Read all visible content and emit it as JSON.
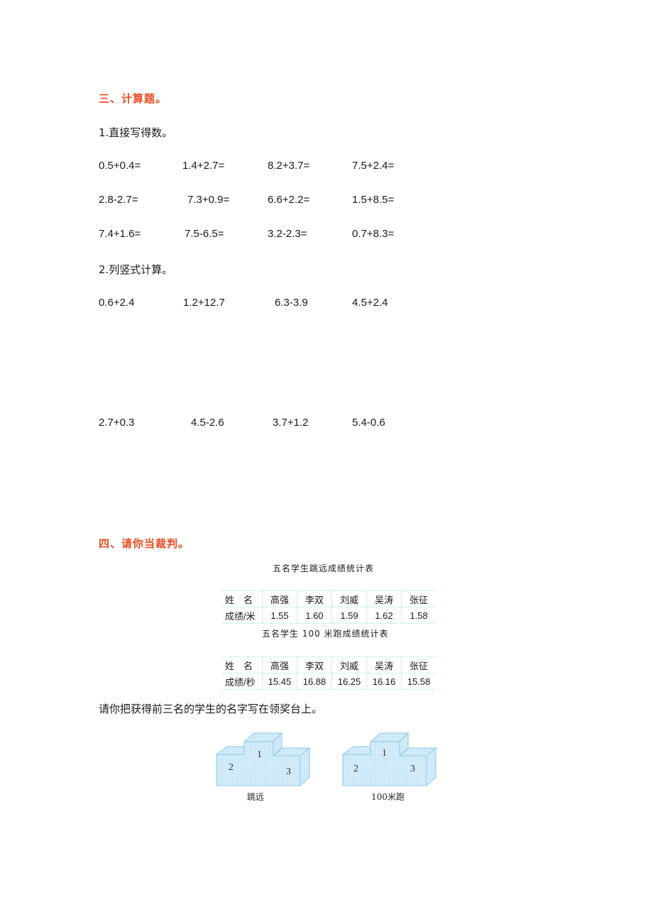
{
  "section3": {
    "title": "三、计算题。",
    "part1": {
      "heading": "1.直接写得数。",
      "rows": [
        [
          "0.5+0.4=",
          "1.4+2.7=",
          "8.2+3.7=",
          "7.5+2.4="
        ],
        [
          "2.8-2.7=",
          "7.3+0.9=",
          "6.6+2.2=",
          "1.5+8.5="
        ],
        [
          "7.4+1.6=",
          "7.5-6.5=",
          "3.2-2.3=",
          "0.7+8.3="
        ]
      ]
    },
    "part2": {
      "heading": "2.列竖式计算。",
      "rows": [
        [
          "0.6+2.4",
          "1.2+12.7",
          "6.3-3.9",
          "4.5+2.4"
        ],
        [
          "2.7+0.3",
          "4.5-2.6",
          "3.7+1.2",
          "5.4-0.6"
        ]
      ]
    }
  },
  "section4": {
    "title": "四、请你当裁判。",
    "tables": [
      {
        "caption": "五名学生跳远成绩统计表",
        "header_label": "姓　名",
        "names": [
          "高强",
          "李双",
          "刘威",
          "吴涛",
          "张征"
        ],
        "score_label": "成绩/米",
        "scores": [
          "1.55",
          "1.60",
          "1.59",
          "1.62",
          "1.58"
        ]
      },
      {
        "caption": "五名学生 100 米跑成绩统计表",
        "header_label": "姓　名",
        "names": [
          "高强",
          "李双",
          "刘威",
          "吴涛",
          "张征"
        ],
        "score_label": "成绩/秒",
        "scores": [
          "15.45",
          "16.88",
          "16.25",
          "16.16",
          "15.58"
        ]
      }
    ],
    "instruction": "请你把获得前三名的学生的名字写在领奖台上。",
    "podiums": [
      {
        "caption": "跳远",
        "places": [
          "1",
          "2",
          "3"
        ]
      },
      {
        "caption": "100米跑",
        "places": [
          "1",
          "2",
          "3"
        ]
      }
    ]
  },
  "colors": {
    "section_title": "#f04a1e",
    "table_border": "#9ee8ee",
    "podium_fill": "#cfe9f7",
    "podium_stroke": "#8cc8ea"
  }
}
